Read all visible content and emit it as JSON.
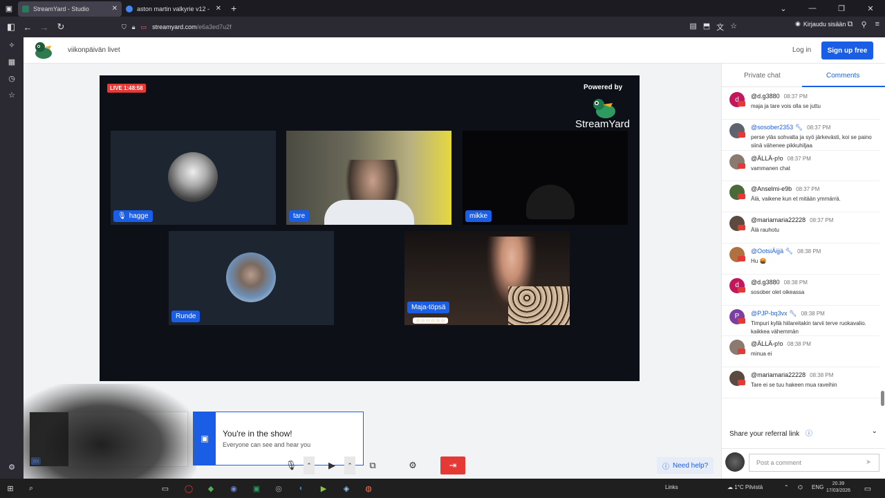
{
  "browser": {
    "tabs": [
      {
        "title": "StreamYard - Studio",
        "active": true
      },
      {
        "title": "aston martin valkyrie v12 - Goo",
        "active": false
      }
    ],
    "url_domain": "streamyard.com",
    "url_path": "/e6a3ed7u2f",
    "signin_label": "Kirjaudu sisään"
  },
  "site": {
    "show_name": "viikonpäivän livet",
    "login_label": "Log in",
    "signup_label": "Sign up free"
  },
  "stage": {
    "live_badge": "LIVE 1:48:58",
    "powered_by": "Powered by",
    "brand": "StreamYard",
    "participants": [
      {
        "name": "hagge",
        "muted": true
      },
      {
        "name": "tare"
      },
      {
        "name": "mikke"
      },
      {
        "name": "Runde"
      },
      {
        "name": "Maja-töpsä",
        "badge": "☆☆☆☆☆☆"
      }
    ],
    "self_label": "mi",
    "in_show_title": "You're in the show!",
    "in_show_sub": "Everyone can see and hear you",
    "help_label": "Need help?"
  },
  "panel": {
    "tabs": [
      "Private chat",
      "Comments"
    ],
    "active_tab": "Comments",
    "comments": [
      {
        "user": "@d.g3880",
        "time": "08:37 PM",
        "text": "maja ja tare vois olla se juttu",
        "avatar_letter": "d",
        "avatar_color": "#c2185b",
        "mod": false
      },
      {
        "user": "@sosober2353",
        "time": "08:37 PM",
        "text": "perse yläs sohvalta ja syö järkevästi, koi se paino siinä vähenee pikkuhiljaa",
        "avatar_letter": "",
        "avatar_color": "#5d6470",
        "mod": true
      },
      {
        "user": "@ÄLLÄ-p!o",
        "time": "08:37 PM",
        "text": "vammanen chat",
        "avatar_letter": "",
        "avatar_color": "#8a7a70",
        "mod": false
      },
      {
        "user": "@Anselmi-e9b",
        "time": "08:37 PM",
        "text": "Älä, vaikene kun et mitään ymmärrä.",
        "avatar_letter": "",
        "avatar_color": "#4a6a3a",
        "mod": false
      },
      {
        "user": "@mariamaria22228",
        "time": "08:37 PM",
        "text": "Älä rauhotu",
        "avatar_letter": "",
        "avatar_color": "#5a4a40",
        "mod": false
      },
      {
        "user": "@OotsiÄijjä",
        "time": "08:38 PM",
        "text": "Hu 🤬",
        "avatar_letter": "",
        "avatar_color": "#b07040",
        "mod": true
      },
      {
        "user": "@d.g3880",
        "time": "08:38 PM",
        "text": "sosober olet oikeassa",
        "avatar_letter": "d",
        "avatar_color": "#c2185b",
        "mod": false
      },
      {
        "user": "@PJP-bq3vx",
        "time": "08:38 PM",
        "text": "Timpuri kyllä hiilareitakin tarvii terve ruokavalio. kaikkea vähemmän",
        "avatar_letter": "P",
        "avatar_color": "#7b3fa0",
        "mod": true
      },
      {
        "user": "@ÄLLÄ-p!o",
        "time": "08:38 PM",
        "text": "minua ei",
        "avatar_letter": "",
        "avatar_color": "#8a7a70",
        "mod": false
      },
      {
        "user": "@mariamaria22228",
        "time": "08:38 PM",
        "text": "Tare ei se tuu hakeen mua raveihin",
        "avatar_letter": "",
        "avatar_color": "#5a4a40",
        "mod": false
      }
    ],
    "referral_label": "Share your referral link",
    "comment_placeholder": "Post a comment"
  },
  "taskbar": {
    "links_label": "Links",
    "weather": "1°C Pilvistä",
    "lang": "ENG",
    "time": "20.39",
    "date": "17/03/2026"
  },
  "colors": {
    "accent": "#1a5ee6",
    "live_red": "#e53935",
    "browser_dark": "#2b2a33"
  }
}
